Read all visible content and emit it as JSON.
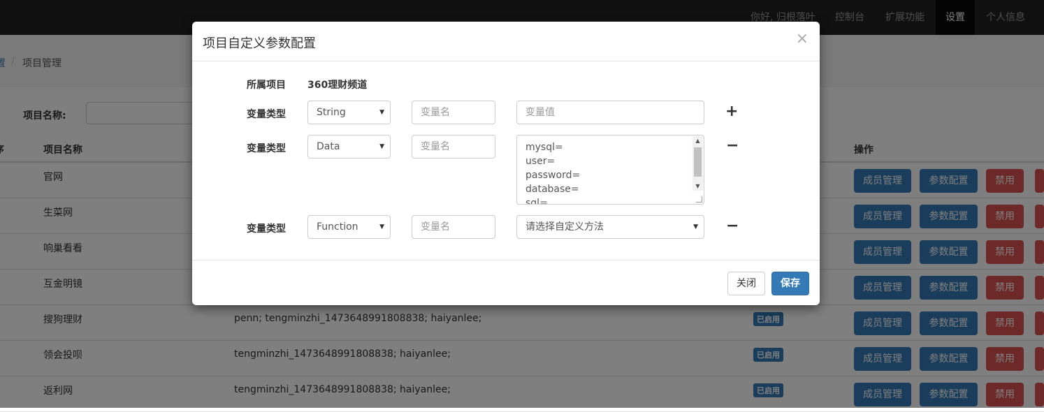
{
  "navbar": {
    "items": [
      "你好, 归根落叶",
      "控制台",
      "扩展功能",
      "设置",
      "个人信息"
    ]
  },
  "breadcrumb": {
    "link": "置",
    "separator": "/",
    "current": "项目管理"
  },
  "search": {
    "label": "项目名称:"
  },
  "table": {
    "headers": {
      "first": "序",
      "name": "项目名称",
      "ops": "操作"
    },
    "rows": [
      {
        "name": "官网",
        "members": "",
        "status": ""
      },
      {
        "name": "生菜网",
        "members": "",
        "status": ""
      },
      {
        "name": "响巢看看",
        "members": "",
        "status": ""
      },
      {
        "name": "互金明镜",
        "members": "",
        "status": ""
      },
      {
        "name": "搜狗理财",
        "members": "penn; tengminzhi_1473648991808838; haiyanlee;",
        "status": "已启用"
      },
      {
        "name": "领会投呗",
        "members": "tengminzhi_1473648991808838; haiyanlee;",
        "status": "已启用"
      },
      {
        "name": "返利网",
        "members": "tengminzhi_1473648991808838; haiyanlee;",
        "status": "已启用"
      }
    ],
    "actions": {
      "members": "成员管理",
      "params": "参数配置",
      "disable": "禁用"
    }
  },
  "modal": {
    "title": "项目自定义参数配置",
    "close_icon": "×",
    "project_label": "所属项目",
    "project_value": "360理财频道",
    "var_type_label": "变量类型",
    "rows": [
      {
        "type": "String",
        "name_placeholder": "变量名",
        "value_placeholder": "变量值",
        "op": "+"
      },
      {
        "type": "Data",
        "name_placeholder": "变量名",
        "value_lines": [
          "mysql=",
          "user=",
          "password=",
          "database=",
          "sql="
        ],
        "op": "−"
      },
      {
        "type": "Function",
        "name_placeholder": "变量名",
        "method_select": "请选择自定义方法",
        "op": "−"
      }
    ],
    "footer": {
      "close_label": "关闭",
      "save_label": "保存"
    }
  },
  "colors": {
    "primary": "#337ab7",
    "danger": "#d9534f",
    "navbar": "#222222"
  }
}
